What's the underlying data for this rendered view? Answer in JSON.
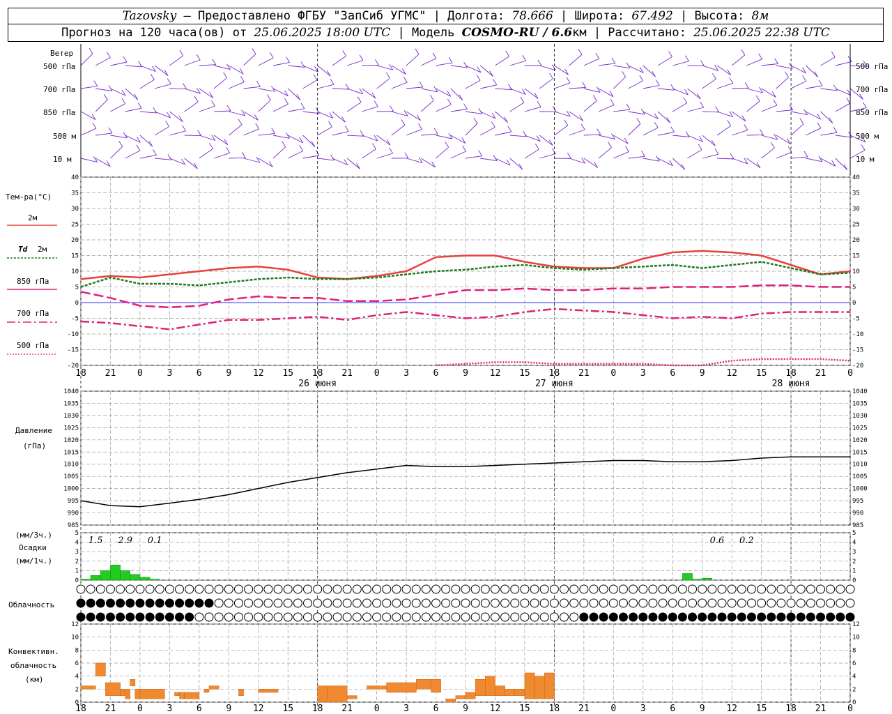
{
  "header": {
    "station": "Tazovsky",
    "provider": " — Предоставлено ФГБУ \"ЗапСиб УГМС\" | Долгота: ",
    "lon": "78.666",
    "lat_label": " | Широта: ",
    "lat": "67.492",
    "alt_label": " | Высота: ",
    "alt": "8м",
    "forecast_label": "Прогноз на 120 часа(ов) от ",
    "forecast_from": "25.06.2025 18:00 UTC",
    "model_label": " | Модель ",
    "model": "COSMO-RU / 6.6",
    "model_unit": "км",
    "calc_label": " | Рассчитано: ",
    "calc_time": "25.06.2025 22:38 UTC"
  },
  "labels": {
    "wind": "Ветер",
    "levels": [
      "500 гПа",
      "700 гПа",
      "850 гПа",
      "500 м",
      "10  м"
    ],
    "temp_title": "Тем-ра(°C)",
    "t2m": "2м",
    "td_label": "Td",
    "td_2m": "2м",
    "t850": "850 гПа",
    "t700": "700 гПа",
    "t500": "500 гПа",
    "pressure_title": "Давление",
    "pressure_unit": "(гПа)",
    "precip_unit3": "(мм/3ч.)",
    "precip_title": "Осадки",
    "precip_unit1": "(мм/1ч.)",
    "cloud_title": "Облачность",
    "conv_title1": "Конвективн.",
    "conv_title2": "облачность",
    "conv_unit": "(км)"
  },
  "colors": {
    "t2m": "#e8403c",
    "td": "#1a7a1a",
    "t850": "#e0207a",
    "t700": "#e0207a",
    "t500": "#e0207a",
    "wind": "#7a28c8",
    "precip": "#22cc22",
    "conv": "#f08a30",
    "zero_line": "#3030ff"
  },
  "chart_data": [
    {
      "type": "line",
      "title": "Тем-ра(°C)",
      "x_ticks": [
        "18",
        "21",
        "0",
        "3",
        "6",
        "9",
        "12",
        "15",
        "18",
        "21",
        "0",
        "3",
        "6",
        "9",
        "12",
        "15",
        "18",
        "21",
        "0",
        "3",
        "6",
        "9",
        "12",
        "15",
        "18",
        "21",
        "0"
      ],
      "date_labels": [
        {
          "tick": 8,
          "text": "26 июня"
        },
        {
          "tick": 16,
          "text": "27 июня"
        },
        {
          "tick": 24,
          "text": "28 июня"
        }
      ],
      "ylim": [
        -20,
        40
      ],
      "yticks": [
        -20,
        -15,
        -10,
        -5,
        0,
        5,
        10,
        15,
        20,
        25,
        30,
        35,
        40
      ],
      "x_hours": [
        0,
        3,
        6,
        9,
        12,
        15,
        18,
        21,
        24,
        27,
        30,
        33,
        36,
        39,
        42,
        45,
        48,
        51,
        54,
        57,
        60,
        63,
        66,
        69,
        72,
        75,
        78
      ],
      "series": [
        {
          "name": "2м",
          "values": [
            7.5,
            8.5,
            8,
            9,
            10,
            11,
            11.5,
            10.5,
            8,
            7.5,
            8.5,
            10,
            14.5,
            15,
            15,
            13,
            11.5,
            11,
            11,
            14,
            16,
            16.5,
            16,
            15,
            12,
            9,
            10
          ]
        },
        {
          "name": "Td 2м",
          "values": [
            5,
            8,
            6,
            6,
            5.5,
            6.5,
            7.5,
            8,
            7.5,
            7.5,
            8,
            9,
            10,
            10.5,
            11.5,
            12,
            11,
            10.5,
            11,
            11.5,
            12,
            11,
            12,
            13,
            11,
            9,
            9.5
          ]
        },
        {
          "name": "850 гПа",
          "values": [
            3.5,
            1.5,
            -1,
            -1.5,
            -1,
            1,
            2,
            1.5,
            1.5,
            0.5,
            0.5,
            1,
            2.5,
            4,
            4,
            4.5,
            4,
            4,
            4.5,
            4.5,
            5,
            5,
            5,
            5.5,
            5.5,
            5,
            5
          ]
        },
        {
          "name": "700 гПа",
          "values": [
            -6,
            -6.5,
            -7.5,
            -8.5,
            -7,
            -5.5,
            -5.5,
            -5,
            -4.5,
            -5.5,
            -4,
            -3,
            -4,
            -5,
            -4.5,
            -3,
            -2,
            -2.5,
            -3,
            -4,
            -5,
            -4.5,
            -5,
            -3.5,
            -3,
            -3,
            -3
          ]
        },
        {
          "name": "500 гПа",
          "values": [
            null,
            null,
            null,
            null,
            null,
            null,
            null,
            null,
            null,
            null,
            null,
            null,
            -20,
            -19.5,
            -19,
            -19,
            -19.5,
            -19.5,
            -19.5,
            -19.5,
            -20,
            -20,
            -18.5,
            -18,
            -18,
            -18,
            -18.5
          ]
        }
      ]
    },
    {
      "type": "line",
      "title": "Давление",
      "ylim": [
        985,
        1040
      ],
      "yticks": [
        985,
        990,
        995,
        1000,
        1005,
        1010,
        1015,
        1020,
        1025,
        1030,
        1035,
        1040
      ],
      "x_hours": [
        0,
        3,
        6,
        9,
        12,
        15,
        18,
        21,
        24,
        27,
        30,
        33,
        36,
        39,
        42,
        45,
        48,
        51,
        54,
        57,
        60,
        63,
        66,
        69,
        72,
        75,
        78
      ],
      "values": [
        995,
        993,
        992.5,
        994,
        995.5,
        997.5,
        1000,
        1002.5,
        1004.5,
        1006.5,
        1008,
        1009.5,
        1009,
        1009,
        1009.5,
        1010,
        1010.5,
        1011,
        1011.5,
        1011.5,
        1011,
        1011,
        1011.5,
        1012.5,
        1013,
        1013,
        1013
      ]
    },
    {
      "type": "bar",
      "title": "Осадки",
      "ylim": [
        0,
        5
      ],
      "yticks": [
        0,
        1,
        2,
        3,
        4,
        5
      ],
      "x_hours": [
        0,
        1,
        2,
        3,
        4,
        5,
        6,
        7,
        61,
        62,
        63
      ],
      "values": [
        0.1,
        0.5,
        1.0,
        1.6,
        1.0,
        0.6,
        0.3,
        0.1,
        0.7,
        0.1,
        0.2
      ],
      "sums_3h": [
        {
          "hour": 1.5,
          "text": "1.5"
        },
        {
          "hour": 4.5,
          "text": "2.9"
        },
        {
          "hour": 7.5,
          "text": "0.1"
        },
        {
          "hour": 64.5,
          "text": "0.6"
        },
        {
          "hour": 67.5,
          "text": "0.2"
        }
      ]
    },
    {
      "type": "bar",
      "title": "Конвективн. облачность",
      "ylim": [
        0,
        12
      ],
      "yticks": [
        0,
        2,
        4,
        6,
        8,
        10,
        12
      ],
      "segments": [
        {
          "from": 0,
          "to": 1,
          "bottom": 2,
          "top": 2.5
        },
        {
          "from": 1,
          "to": 1.5,
          "bottom": 2,
          "top": 2.5
        },
        {
          "from": 1.5,
          "to": 2.5,
          "bottom": 4,
          "top": 6
        },
        {
          "from": 2.5,
          "to": 4,
          "bottom": 1,
          "top": 3
        },
        {
          "from": 4,
          "to": 4.5,
          "bottom": 1,
          "top": 2
        },
        {
          "from": 4.5,
          "to": 5,
          "bottom": 0.5,
          "top": 2
        },
        {
          "from": 5,
          "to": 5.5,
          "bottom": 2.5,
          "top": 3.5
        },
        {
          "from": 5.5,
          "to": 6,
          "bottom": 0.5,
          "top": 2
        },
        {
          "from": 6,
          "to": 8.5,
          "bottom": 0.5,
          "top": 2
        },
        {
          "from": 9.5,
          "to": 10,
          "bottom": 1,
          "top": 1.5
        },
        {
          "from": 10,
          "to": 10.5,
          "bottom": 0.5,
          "top": 1.5
        },
        {
          "from": 10.5,
          "to": 12,
          "bottom": 0.5,
          "top": 1.5
        },
        {
          "from": 12.5,
          "to": 13,
          "bottom": 1.5,
          "top": 2
        },
        {
          "from": 13,
          "to": 14,
          "bottom": 2,
          "top": 2.5
        },
        {
          "from": 16,
          "to": 16.5,
          "bottom": 1,
          "top": 2
        },
        {
          "from": 18,
          "to": 20,
          "bottom": 1.5,
          "top": 2
        },
        {
          "from": 24,
          "to": 25,
          "bottom": 0,
          "top": 2.5
        },
        {
          "from": 25,
          "to": 27,
          "bottom": 0,
          "top": 2.5
        },
        {
          "from": 27,
          "to": 28,
          "bottom": 0.5,
          "top": 1
        },
        {
          "from": 29,
          "to": 31,
          "bottom": 2,
          "top": 2.5
        },
        {
          "from": 31,
          "to": 34,
          "bottom": 1.5,
          "top": 3
        },
        {
          "from": 34,
          "to": 35.5,
          "bottom": 2,
          "top": 3.5
        },
        {
          "from": 35.5,
          "to": 36.5,
          "bottom": 1.5,
          "top": 3.5
        },
        {
          "from": 37,
          "to": 38,
          "bottom": 0,
          "top": 0.5
        },
        {
          "from": 38,
          "to": 39,
          "bottom": 0.5,
          "top": 1
        },
        {
          "from": 39,
          "to": 40,
          "bottom": 0.5,
          "top": 1.5
        },
        {
          "from": 40,
          "to": 41,
          "bottom": 1,
          "top": 3.5
        },
        {
          "from": 41,
          "to": 42,
          "bottom": 1,
          "top": 4
        },
        {
          "from": 42,
          "to": 43,
          "bottom": 1,
          "top": 2.5
        },
        {
          "from": 43,
          "to": 44,
          "bottom": 1,
          "top": 2
        },
        {
          "from": 44,
          "to": 45,
          "bottom": 1,
          "top": 2
        },
        {
          "from": 45,
          "to": 46,
          "bottom": 0.5,
          "top": 4.5
        },
        {
          "from": 46,
          "to": 47,
          "bottom": 0.5,
          "top": 4
        },
        {
          "from": 47,
          "to": 48,
          "bottom": 0.5,
          "top": 4.5
        }
      ]
    }
  ]
}
